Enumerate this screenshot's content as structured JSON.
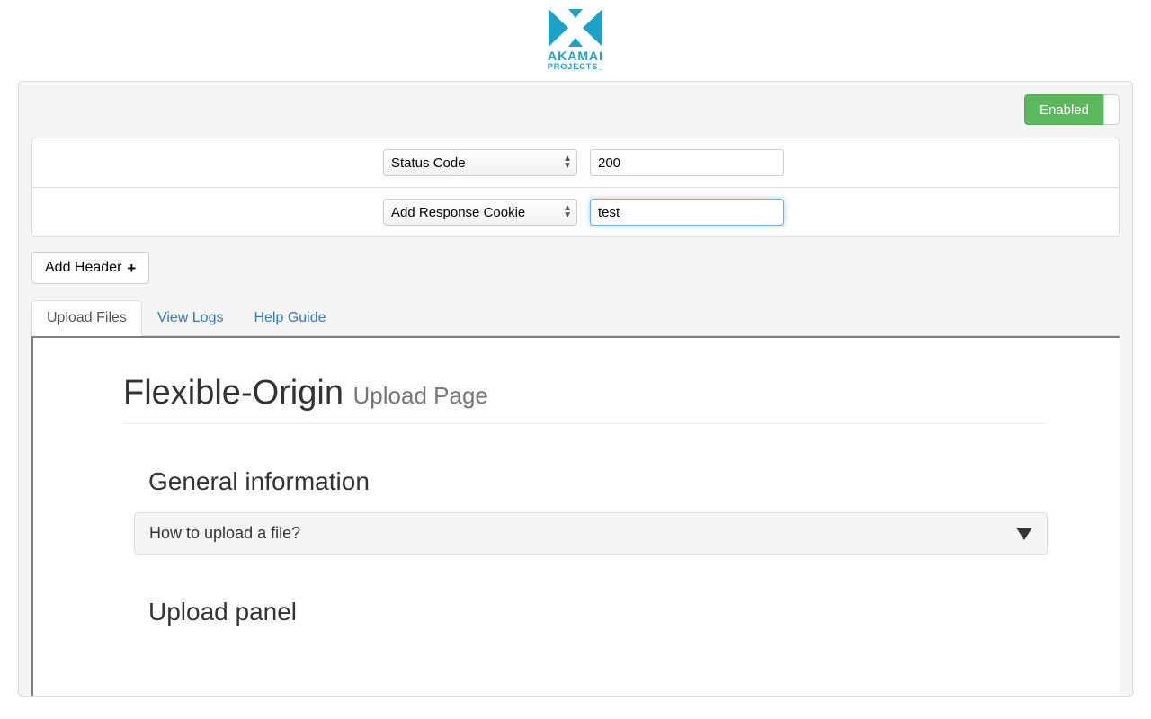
{
  "brand": {
    "name": "AKAMAI",
    "sub": "PROJECTS_",
    "accent": "#1aa3c6"
  },
  "toggle": {
    "label": "Enabled",
    "on": true
  },
  "headers": {
    "rows": [
      {
        "type": "Status Code",
        "value": "200",
        "focused": false
      },
      {
        "type": "Add Response Cookie",
        "value": "test",
        "focused": true
      }
    ],
    "type_options": [
      "Status Code",
      "Add Response Cookie"
    ]
  },
  "buttons": {
    "add_header": "Add Header"
  },
  "tabs": {
    "items": [
      {
        "label": "Upload Files",
        "active": true
      },
      {
        "label": "View Logs",
        "active": false
      },
      {
        "label": "Help Guide",
        "active": false
      }
    ]
  },
  "upload_page": {
    "title": "Flexible-Origin",
    "subtitle": "Upload Page",
    "sections": {
      "general_info": "General information",
      "upload_panel": "Upload panel"
    },
    "accordion": {
      "how_to": "How to upload a file?"
    }
  }
}
